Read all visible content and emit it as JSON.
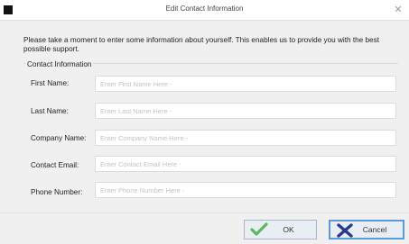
{
  "window": {
    "title": "Edit Contact Information"
  },
  "intro_text": "Please take a moment to enter some information about yourself. This enables us to provide you with the best possible support.",
  "group": {
    "label": "Contact Information"
  },
  "fields": [
    {
      "label": "First Name:",
      "placeholder": "Enter First Name Here -"
    },
    {
      "label": "Last Name:",
      "placeholder": "Enter Last Name Here -"
    },
    {
      "label": "Company Name:",
      "placeholder": "Enter Company Name Here -"
    },
    {
      "label": "Contact Email:",
      "placeholder": "Enter Contact Email Here -"
    },
    {
      "label": "Phone Number:",
      "placeholder": "Enter Phone Number Here -"
    }
  ],
  "buttons": {
    "ok_label": "OK",
    "cancel_label": "Cancel"
  },
  "colors": {
    "ok_icon": "#5cb85c",
    "cancel_icon": "#2b3a8c",
    "focus_border": "#5b9bd5"
  },
  "icons": {
    "app": "app-icon",
    "close": "close-icon",
    "ok": "checkmark-icon",
    "cancel": "x-icon"
  }
}
